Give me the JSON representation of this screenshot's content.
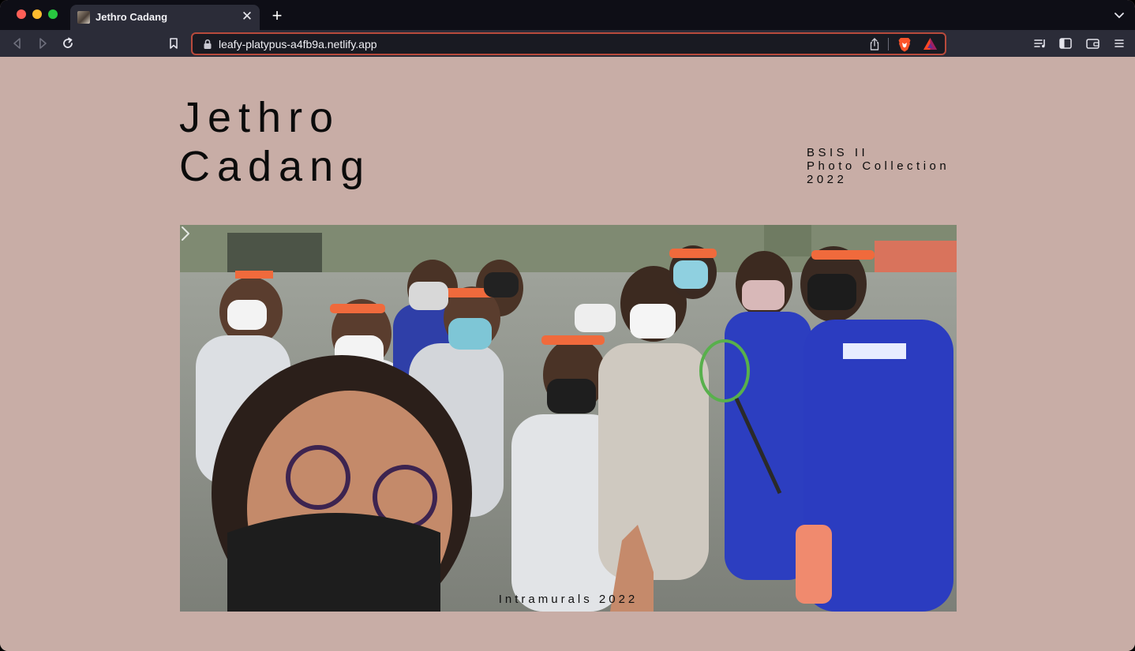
{
  "browser": {
    "tab_title": "Jethro Cadang",
    "url": "leafy-platypus-a4fb9a.netlify.app"
  },
  "header": {
    "name_line1": "Jethro",
    "name_line2": "Cadang",
    "meta_line1": "BSIS II",
    "meta_line2": "Photo Collection",
    "meta_line3": "2022"
  },
  "photo": {
    "caption": "Intramurals 2022"
  },
  "colors": {
    "page_background": "#c8ada6",
    "titlebar": "#0e0e16",
    "toolbar": "#2b2c38",
    "address_border": "#b84a3c"
  },
  "icons": [
    "back-icon",
    "forward-icon",
    "reload-icon",
    "bookmark-icon",
    "lock-icon",
    "share-icon",
    "brave-shield-icon",
    "brave-rewards-icon",
    "playlist-icon",
    "sidebar-icon",
    "wallet-icon",
    "menu-icon",
    "close-icon",
    "plus-icon",
    "chevron-down-icon",
    "chevron-right-icon"
  ]
}
